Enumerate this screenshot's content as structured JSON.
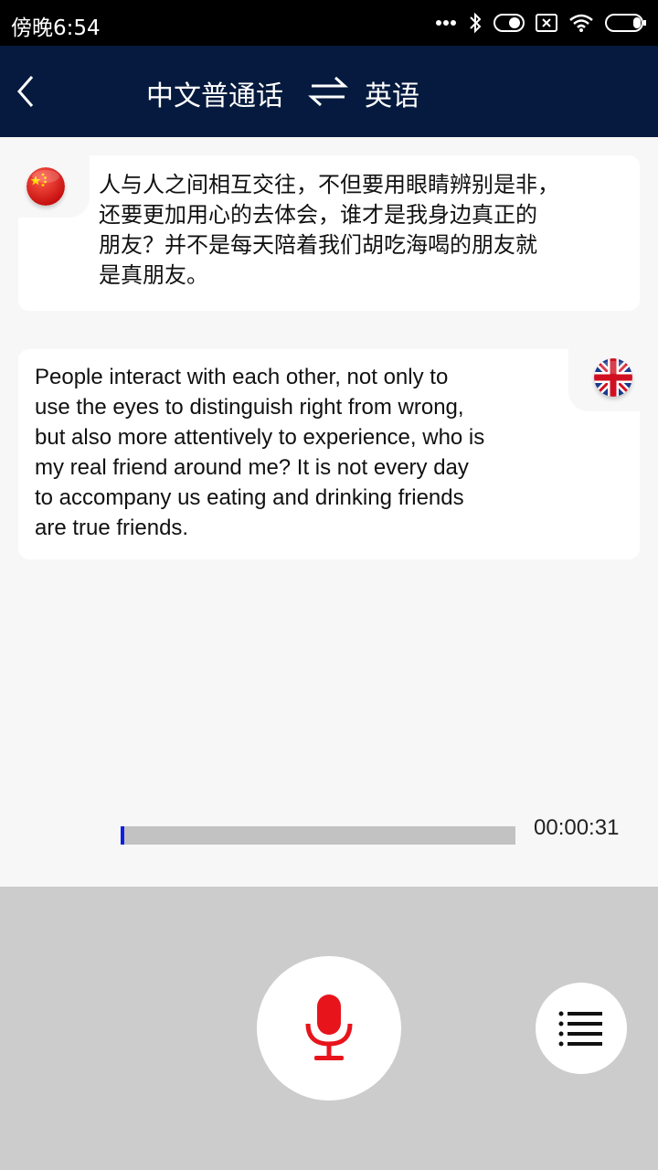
{
  "status_bar": {
    "time": "傍晚6:54",
    "icons": [
      "more-dots-icon",
      "bluetooth-icon",
      "toggle-icon",
      "sim-icon",
      "wifi-icon",
      "battery-icon"
    ]
  },
  "header": {
    "back_icon": "chevron-left-icon",
    "source_language": "中文普通话",
    "swap_icon": "swap-arrows-icon",
    "target_language": "英语",
    "background_color": "#051a3e"
  },
  "conversation": {
    "source_message": {
      "flag": "china-flag-icon",
      "text": "人与人之间相互交往，不但要用眼睛辨别是非，\n还要更加用心的去体会，谁才是我身边真正的\n朋友？并不是每天陪着我们胡吃海喝的朋友就\n是真朋友。"
    },
    "translated_message": {
      "flag": "uk-flag-icon",
      "text": "People interact with each other, not only to\nuse the eyes to distinguish right from wrong,\nbut also more attentively to experience, who is\nmy real friend around me? It is not every day\nto accompany us eating and drinking friends\nare true friends."
    }
  },
  "recorder": {
    "progress_fraction": 0.01,
    "elapsed": "00:00:31",
    "accent_color": "#1020e0"
  },
  "controls": {
    "mic_icon": "microphone-icon",
    "mic_color": "#e8141c",
    "menu_icon": "list-menu-icon"
  }
}
